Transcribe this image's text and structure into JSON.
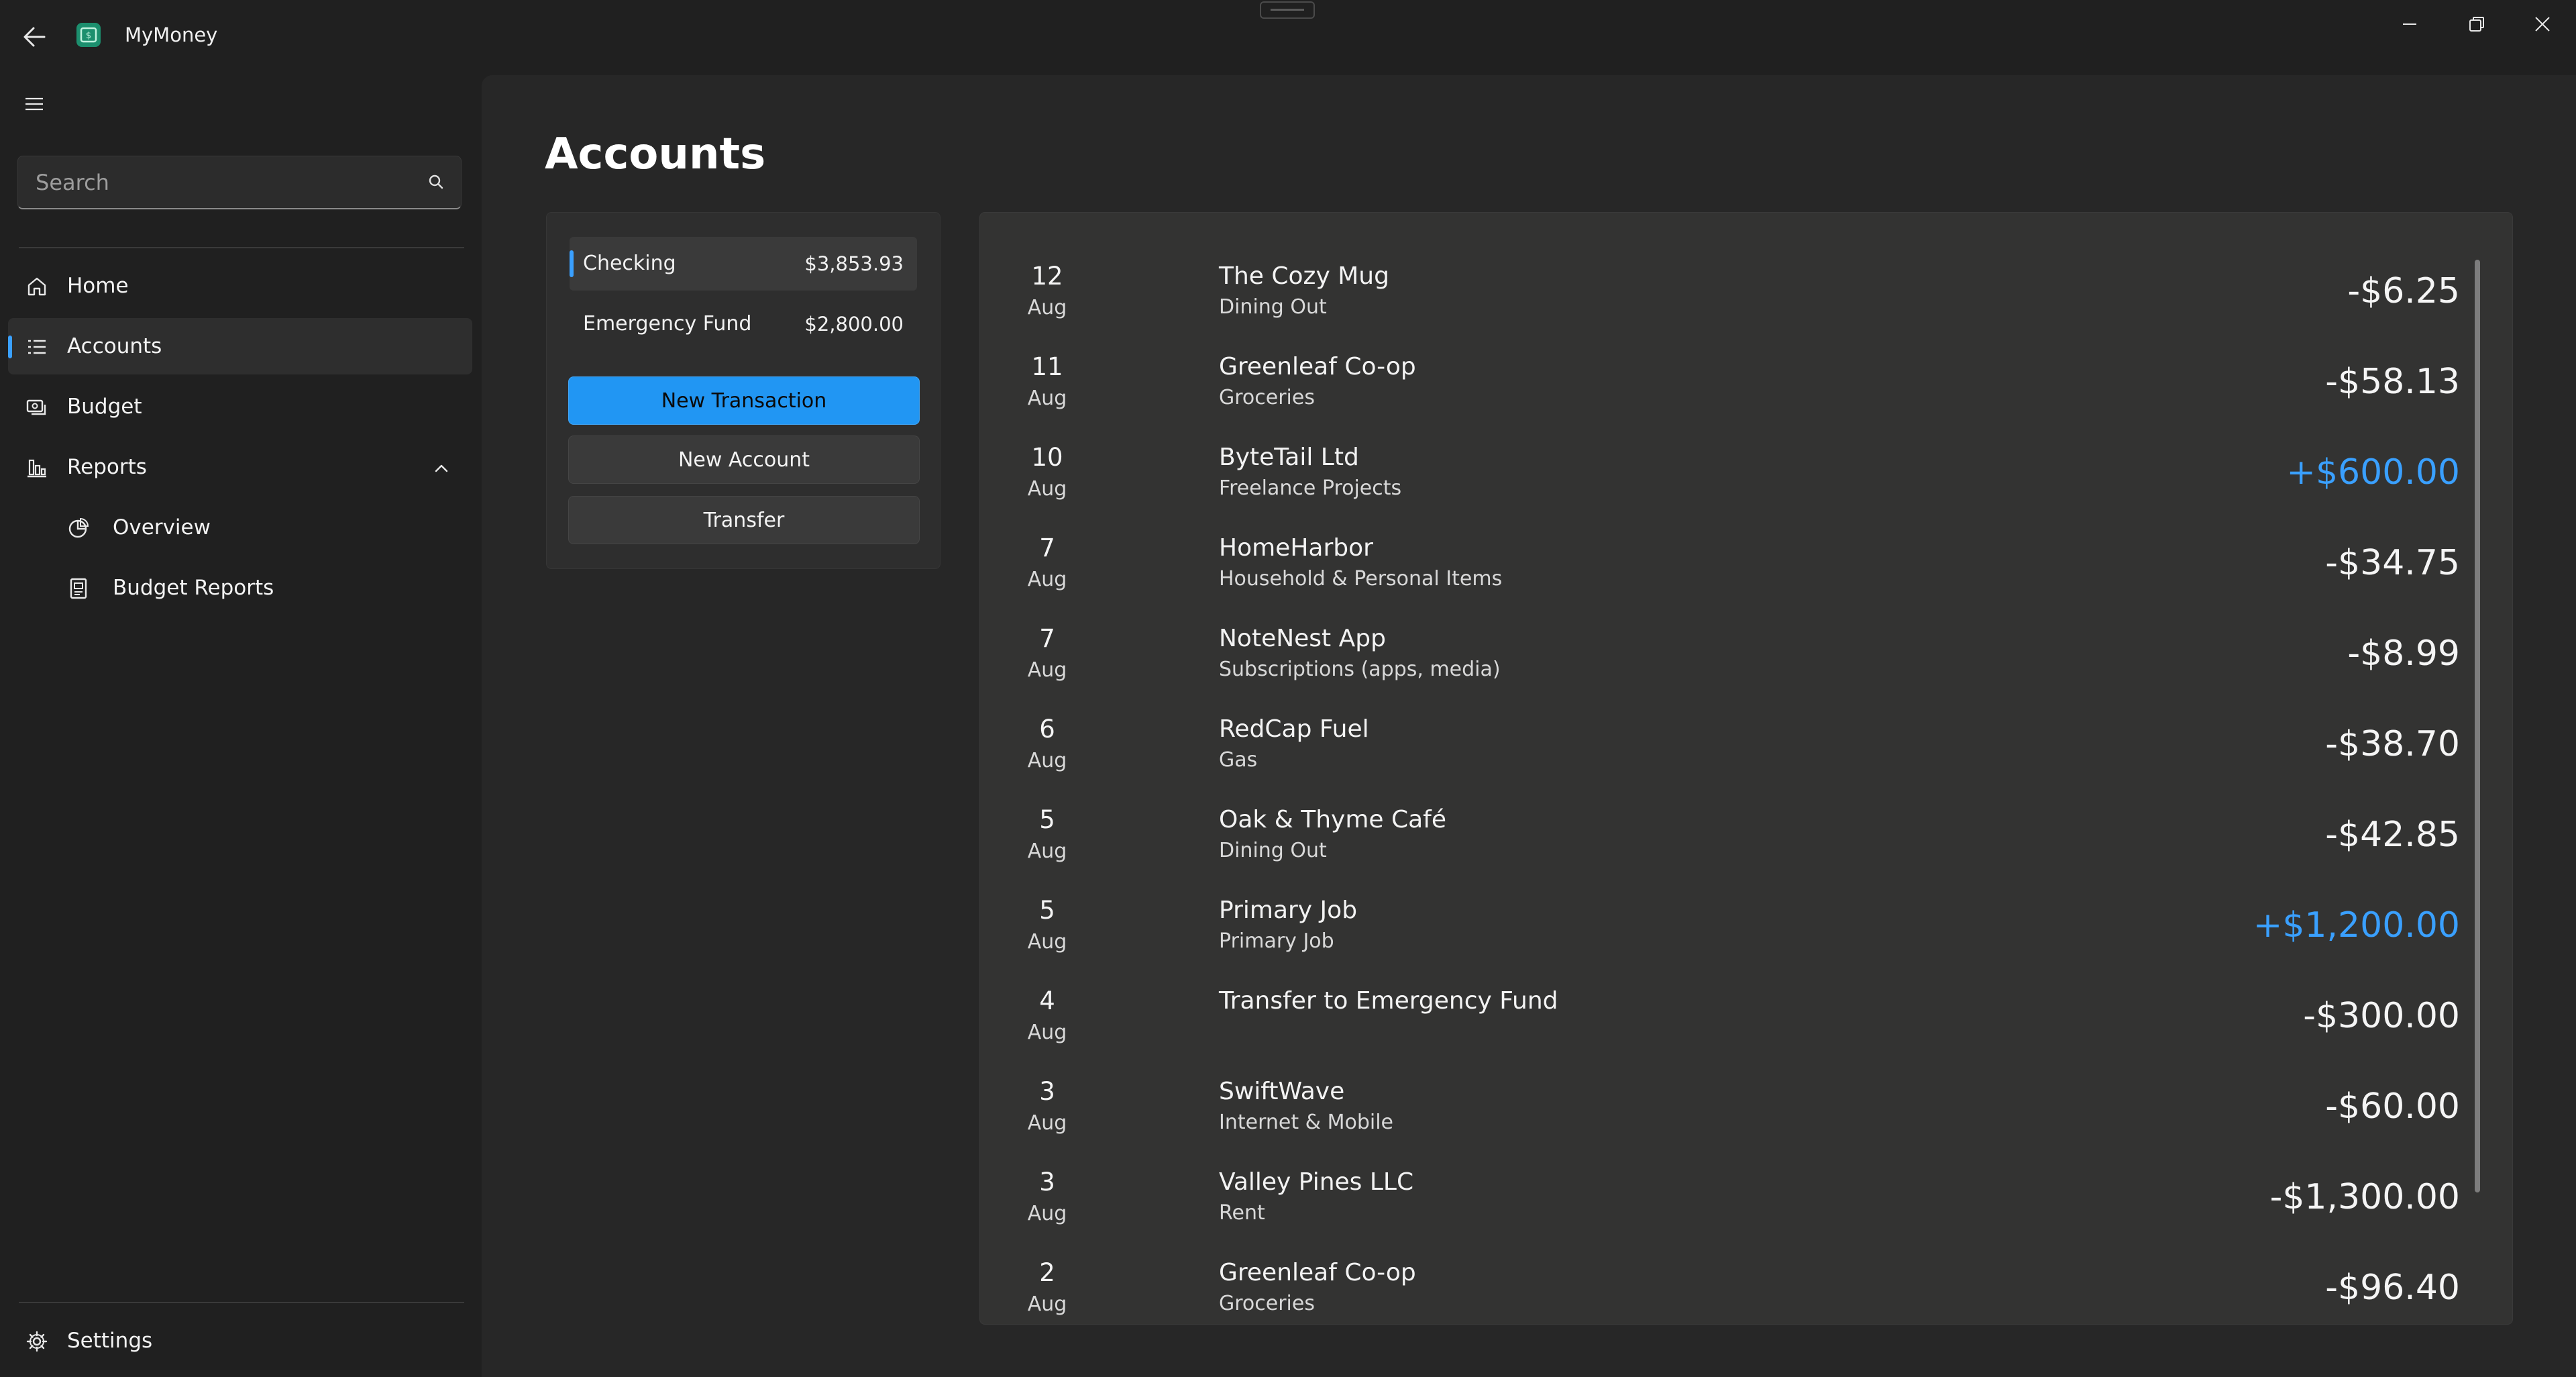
{
  "app": {
    "title": "MyMoney",
    "icon": "app-logo-icon",
    "back_icon": "back-arrow-icon"
  },
  "window_controls": [
    "minimize-icon",
    "maximize-icon",
    "close-icon"
  ],
  "sidebar": {
    "search": {
      "placeholder": "Search",
      "value": ""
    },
    "items": [
      {
        "label": "Home",
        "icon": "home-icon",
        "selected": false
      },
      {
        "label": "Accounts",
        "icon": "list-icon",
        "selected": true
      },
      {
        "label": "Budget",
        "icon": "budget-icon",
        "selected": false
      },
      {
        "label": "Reports",
        "icon": "chart-icon",
        "selected": false,
        "expanded": true
      },
      {
        "label": "Overview",
        "icon": "pie-chart-icon",
        "selected": false
      },
      {
        "label": "Budget Reports",
        "icon": "report-icon",
        "selected": false
      }
    ],
    "settings_label": "Settings"
  },
  "page": {
    "title": "Accounts"
  },
  "accounts": [
    {
      "name": "Checking",
      "balance": "$3,853.93",
      "selected": true
    },
    {
      "name": "Emergency Fund",
      "balance": "$2,800.00",
      "selected": false
    }
  ],
  "actions": {
    "new_transaction": "New Transaction",
    "new_account": "New Account",
    "transfer": "Transfer"
  },
  "transactions": [
    {
      "day": "12",
      "month": "Aug",
      "payee": "The Cozy Mug",
      "category": "Dining Out",
      "amount": "-$6.25"
    },
    {
      "day": "11",
      "month": "Aug",
      "payee": "Greenleaf Co-op",
      "category": "Groceries",
      "amount": "-$58.13"
    },
    {
      "day": "10",
      "month": "Aug",
      "payee": "ByteTail Ltd",
      "category": "Freelance Projects",
      "amount": "+$600.00"
    },
    {
      "day": "7",
      "month": "Aug",
      "payee": "HomeHarbor",
      "category": "Household & Personal Items",
      "amount": "-$34.75"
    },
    {
      "day": "7",
      "month": "Aug",
      "payee": "NoteNest App",
      "category": "Subscriptions (apps, media)",
      "amount": "-$8.99"
    },
    {
      "day": "6",
      "month": "Aug",
      "payee": "RedCap Fuel",
      "category": "Gas",
      "amount": "-$38.70"
    },
    {
      "day": "5",
      "month": "Aug",
      "payee": "Oak & Thyme Café",
      "category": "Dining Out",
      "amount": "-$42.85"
    },
    {
      "day": "5",
      "month": "Aug",
      "payee": "Primary Job",
      "category": "Primary Job",
      "amount": "+$1,200.00"
    },
    {
      "day": "4",
      "month": "Aug",
      "payee": "Transfer to Emergency Fund",
      "category": "",
      "amount": "-$300.00"
    },
    {
      "day": "3",
      "month": "Aug",
      "payee": "SwiftWave",
      "category": "Internet & Mobile",
      "amount": "-$60.00"
    },
    {
      "day": "3",
      "month": "Aug",
      "payee": "Valley Pines LLC",
      "category": "Rent",
      "amount": "-$1,300.00"
    },
    {
      "day": "2",
      "month": "Aug",
      "payee": "Greenleaf Co-op",
      "category": "Groceries",
      "amount": "-$96.40"
    }
  ],
  "colors": {
    "accent": "#3aa0ff",
    "primary_button": "#2196f3",
    "income": "#3aa0ff"
  }
}
